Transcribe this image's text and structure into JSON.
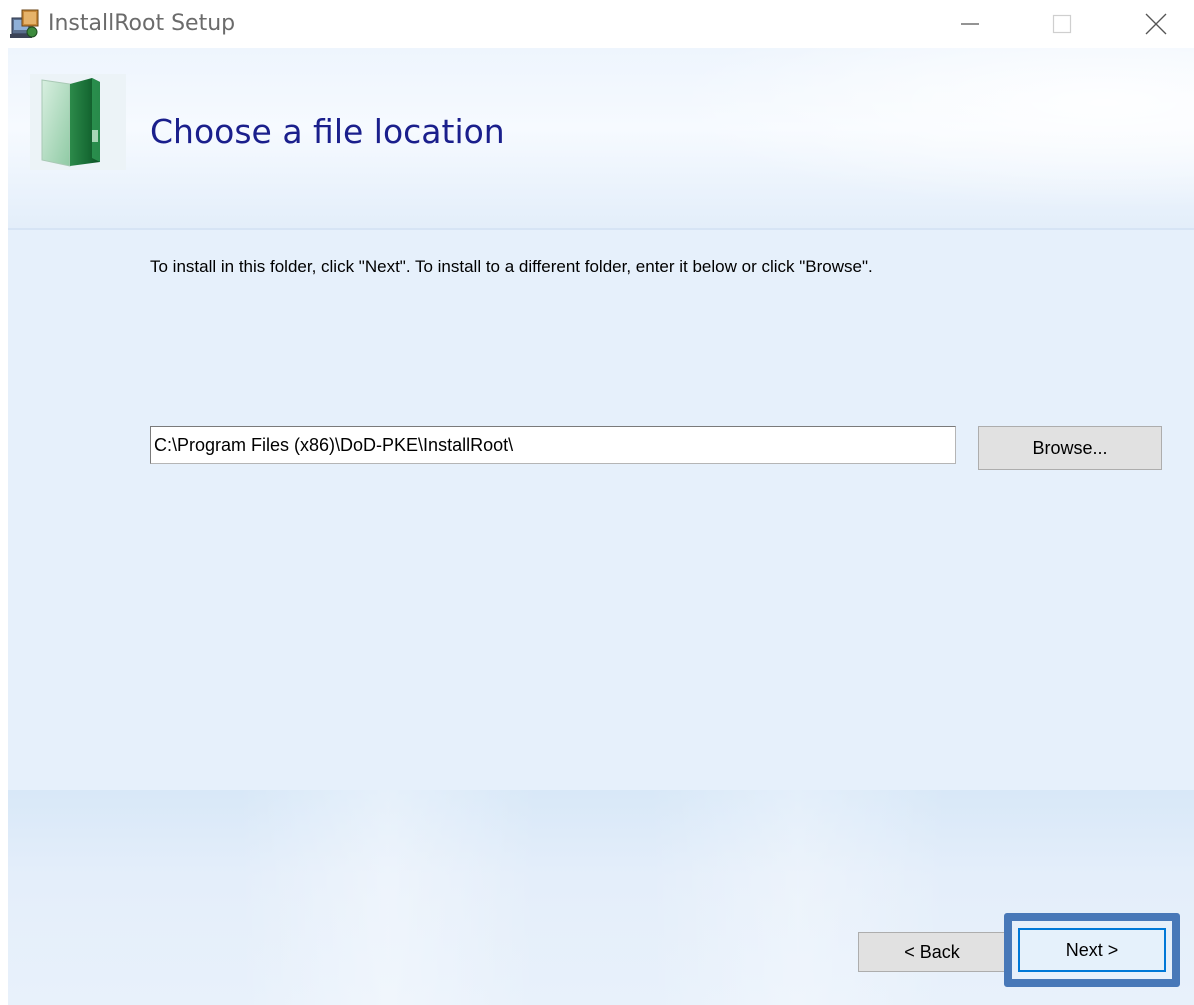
{
  "window": {
    "title": "InstallRoot Setup",
    "controls": {
      "minimize_label": "—",
      "maximize_label": "□",
      "close_label": "✕"
    }
  },
  "header": {
    "icon": "folder-icon",
    "title": "Choose a file location"
  },
  "body": {
    "instruction": "To install in this folder, click \"Next\". To install to a different folder, enter it below or click \"Browse\".",
    "install_path": "C:\\Program Files (x86)\\DoD-PKE\\InstallRoot\\",
    "browse_label": "Browse..."
  },
  "footer": {
    "back_label": "< Back",
    "next_label": "Next >"
  },
  "colors": {
    "title_blue": "#1a1f8c",
    "client_background": "#e6f0fb",
    "highlight_border": "#4878b8",
    "focus_blue": "#0078d7"
  }
}
